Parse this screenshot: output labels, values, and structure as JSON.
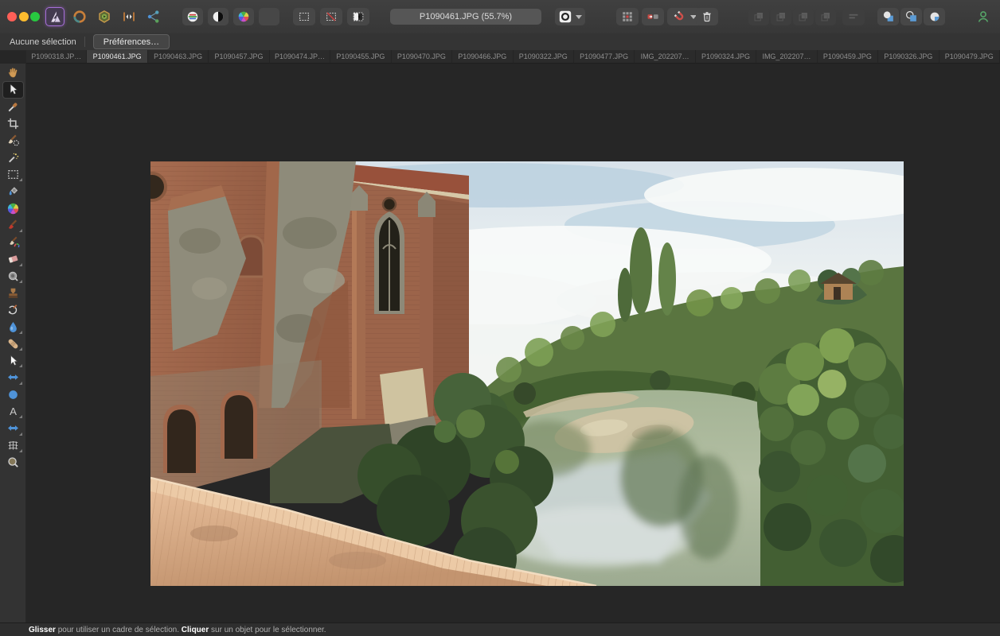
{
  "colors": {
    "traffic_red": "#ff5f57",
    "traffic_yellow": "#febc2e",
    "traffic_green": "#28c840",
    "persona_accent_purple": "#a66fd8",
    "magnet_red": "#cc4f4a",
    "insert_blue": "#5b9bd5",
    "account_green": "#56a568",
    "toolbar_bg": "#3a3a3a",
    "canvas_bg": "#262626"
  },
  "toolbar": {
    "document_title": "P1090461.JPG (55.7%)",
    "personas": [
      {
        "name": "photo-persona",
        "icon": "b-aplogo",
        "active": true
      },
      {
        "name": "develop-persona",
        "icon": "b-ring",
        "active": false
      },
      {
        "name": "tone-mapping-persona",
        "icon": "b-hex",
        "active": false
      },
      {
        "name": "liquify-persona",
        "icon": "b-liquify",
        "active": false
      },
      {
        "name": "export-persona",
        "icon": "b-share",
        "active": false
      }
    ],
    "auto_adjustments": [
      {
        "name": "auto-levels-button",
        "icon": "b-autolevels"
      },
      {
        "name": "auto-contrast-button",
        "icon": "b-autocontrast"
      },
      {
        "name": "auto-colours-button",
        "icon": "t-colorwheel"
      },
      {
        "name": "auto-white-balance-button",
        "icon": "b-autowb"
      }
    ]
  },
  "tabs": [
    {
      "label": "P1090318.JP…",
      "active": false
    },
    {
      "label": "P1090461.JPG",
      "active": true
    },
    {
      "label": "P1090463.JPG",
      "active": false
    },
    {
      "label": "P1090457.JPG",
      "active": false
    },
    {
      "label": "P1090474.JP…",
      "active": false
    },
    {
      "label": "P1090455.JPG",
      "active": false
    },
    {
      "label": "P1090470.JPG",
      "active": false
    },
    {
      "label": "P1090466.JPG",
      "active": false
    },
    {
      "label": "P1090322.JPG",
      "active": false
    },
    {
      "label": "P1090477.JPG",
      "active": false
    },
    {
      "label": "IMG_202207…",
      "active": false
    },
    {
      "label": "P1090324.JPG",
      "active": false
    },
    {
      "label": "IMG_202207…",
      "active": false
    },
    {
      "label": "P1090459.JPG",
      "active": false
    },
    {
      "label": "P1090326.JPG",
      "active": false
    },
    {
      "label": "P1090479.JPG",
      "active": false
    }
  ],
  "tools": [
    {
      "name": "view-tool",
      "icon": "t-hand",
      "selected": false,
      "subtools": false
    },
    {
      "name": "move-tool",
      "icon": "t-cursor",
      "selected": true,
      "subtools": false
    },
    {
      "name": "color-picker-tool",
      "icon": "t-eyedropper",
      "selected": false,
      "subtools": false
    },
    {
      "name": "crop-tool",
      "icon": "t-crop",
      "selected": false,
      "subtools": false
    },
    {
      "name": "selection-brush-tool",
      "icon": "t-selbrush",
      "selected": false,
      "subtools": false
    },
    {
      "name": "flood-select-tool",
      "icon": "t-wand",
      "selected": false,
      "subtools": false
    },
    {
      "name": "marquee-tool",
      "icon": "t-marquee",
      "selected": false,
      "subtools": true
    },
    {
      "name": "flood-fill-tool",
      "icon": "t-bucket",
      "selected": false,
      "subtools": false
    },
    {
      "name": "gradient-tool",
      "icon": "t-colorwheel",
      "selected": false,
      "subtools": false
    },
    {
      "name": "paint-brush-tool",
      "icon": "t-brush",
      "selected": false,
      "subtools": true
    },
    {
      "name": "color-replacement-brush-tool",
      "icon": "t-brushwheel",
      "selected": false,
      "subtools": false
    },
    {
      "name": "eraser-tool",
      "icon": "t-eraser",
      "selected": false,
      "subtools": true
    },
    {
      "name": "dodge-brush-tool",
      "icon": "t-lens",
      "selected": false,
      "subtools": true
    },
    {
      "name": "clone-stamp-tool",
      "icon": "t-stamp",
      "selected": false,
      "subtools": false
    },
    {
      "name": "undo-brush-tool",
      "icon": "t-undobrush",
      "selected": false,
      "subtools": false
    },
    {
      "name": "blur-tool",
      "icon": "t-drop",
      "selected": false,
      "subtools": true
    },
    {
      "name": "healing-brush-tool",
      "icon": "t-bandage",
      "selected": false,
      "subtools": true
    },
    {
      "name": "node-tool",
      "icon": "t-nodearrow",
      "selected": false,
      "subtools": true
    },
    {
      "name": "warp-tool",
      "icon": "t-dblarrow",
      "selected": false,
      "subtools": true
    },
    {
      "name": "ellipse-shape-tool",
      "icon": "t-bluecircle",
      "selected": false,
      "subtools": false
    },
    {
      "name": "text-tool",
      "icon": "t-texta",
      "selected": false,
      "subtools": true
    },
    {
      "name": "transform-tool",
      "icon": "t-dblarrow",
      "selected": false,
      "subtools": true
    },
    {
      "name": "mesh-warp-tool",
      "icon": "t-mesh",
      "selected": false,
      "subtools": true
    },
    {
      "name": "zoom-tool",
      "icon": "t-magnifier",
      "selected": false,
      "subtools": false
    }
  ],
  "context_bar": {
    "selection_status": "Aucune sélection",
    "preferences_button": "Préférences…"
  },
  "status_bar": {
    "segments": [
      {
        "text": "Glisser",
        "bold": true
      },
      {
        "text": " pour utiliser un cadre de sélection. ",
        "bold": false
      },
      {
        "text": "Cliquer",
        "bold": true
      },
      {
        "text": " sur un objet pour le sélectionner.",
        "bold": false
      }
    ]
  }
}
